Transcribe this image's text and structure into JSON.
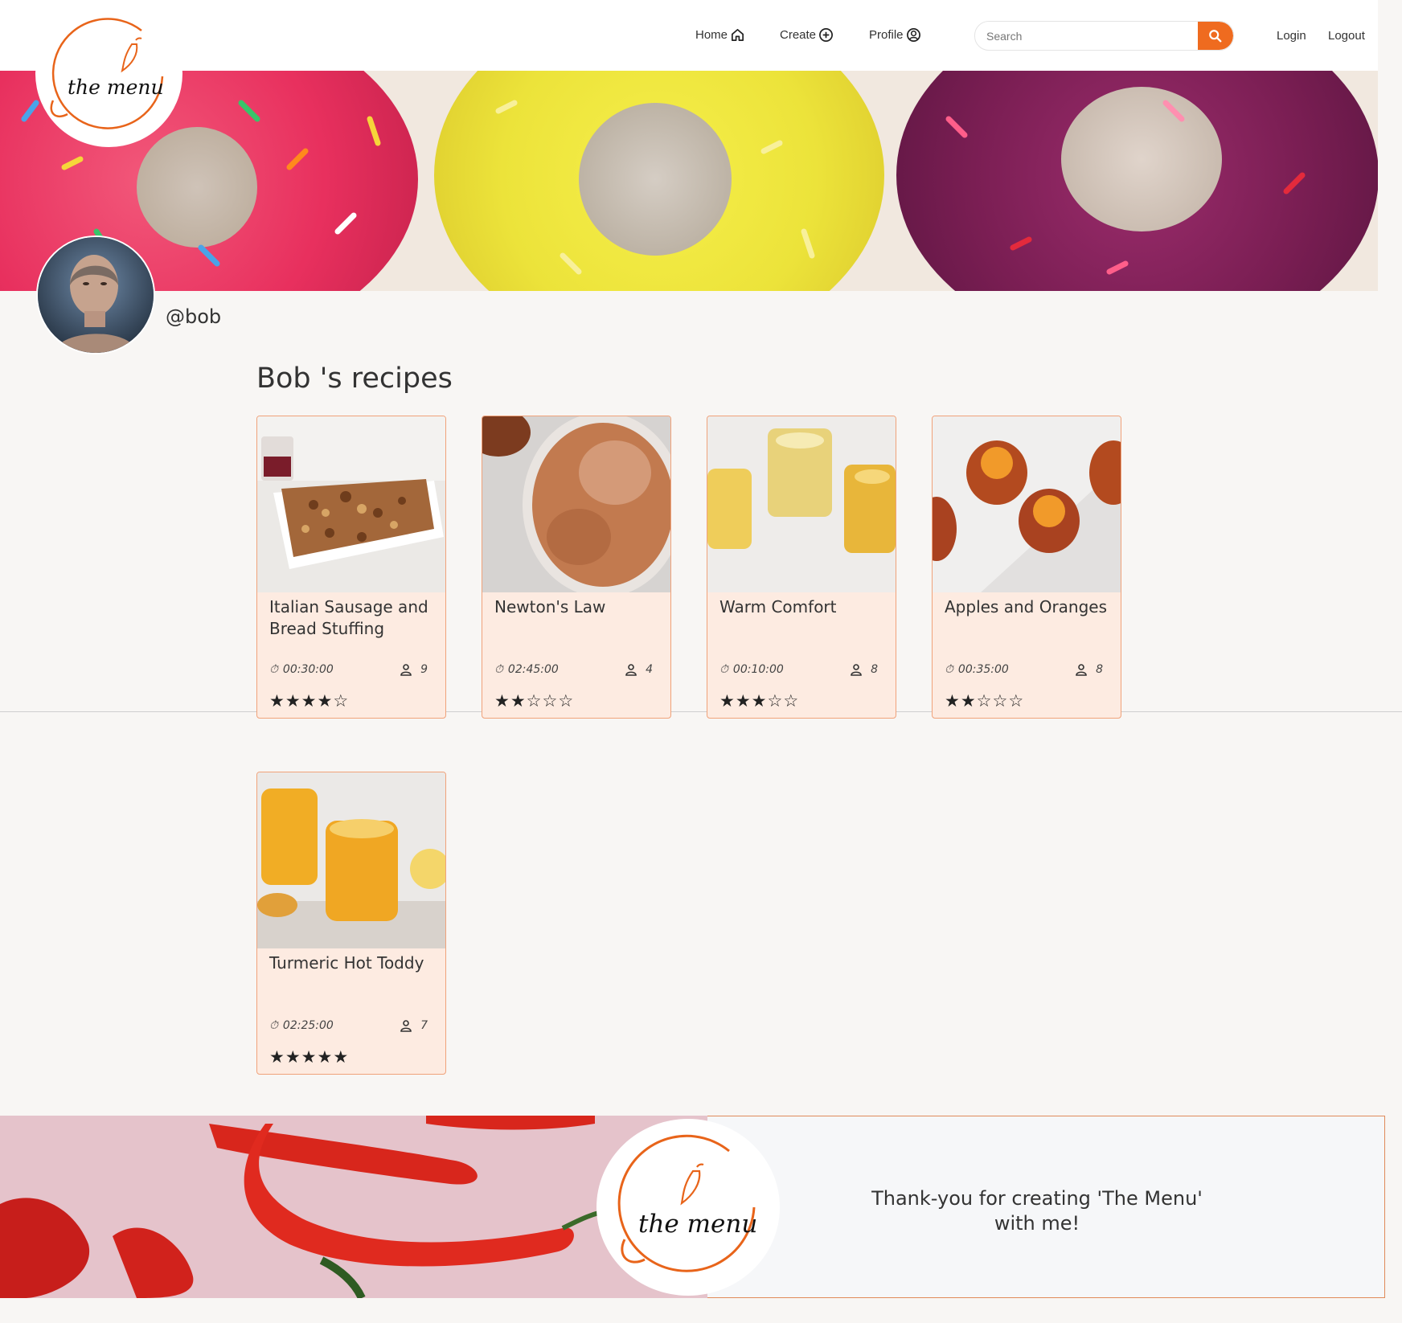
{
  "brand": {
    "logo_text": "the menu"
  },
  "nav": {
    "home": "Home",
    "create": "Create",
    "profile": "Profile",
    "search_placeholder": "Search",
    "login": "Login",
    "logout": "Logout"
  },
  "profile": {
    "username": "@bob",
    "section_title": "Bob 's recipes"
  },
  "recipes": [
    {
      "title": "Italian Sausage and Bread Stuffing",
      "time": "00:30:00",
      "servings": "9",
      "rating": 4
    },
    {
      "title": "Newton's Law",
      "time": "02:45:00",
      "servings": "4",
      "rating": 2
    },
    {
      "title": "Warm Comfort",
      "time": "00:10:00",
      "servings": "8",
      "rating": 3
    },
    {
      "title": "Apples and Oranges",
      "time": "00:35:00",
      "servings": "8",
      "rating": 2
    },
    {
      "title": "Turmeric Hot Toddy",
      "time": "02:25:00",
      "servings": "7",
      "rating": 5
    }
  ],
  "footer": {
    "thanks": "Thank-you for creating 'The Menu' with me!"
  },
  "colors": {
    "accent": "#ef6b1f",
    "card_bg": "#fdebe1",
    "card_border": "#f0a27a"
  }
}
